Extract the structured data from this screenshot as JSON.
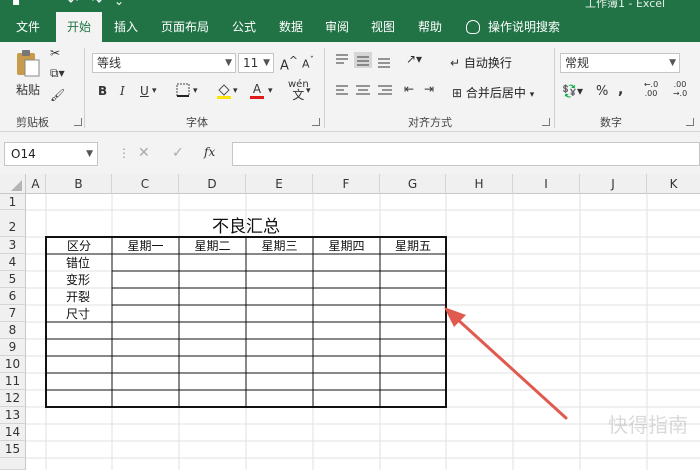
{
  "window": {
    "title_fragment": "工作簿1 - Excel"
  },
  "tabs": [
    {
      "label": "文件",
      "active": false
    },
    {
      "label": "开始",
      "active": true
    },
    {
      "label": "插入",
      "active": false
    },
    {
      "label": "页面布局",
      "active": false
    },
    {
      "label": "公式",
      "active": false
    },
    {
      "label": "数据",
      "active": false
    },
    {
      "label": "审阅",
      "active": false
    },
    {
      "label": "视图",
      "active": false
    },
    {
      "label": "帮助",
      "active": false
    }
  ],
  "tell_me": "操作说明搜索",
  "ribbon": {
    "clipboard": {
      "paste_label": "粘贴",
      "group_label": "剪贴板"
    },
    "font": {
      "font_name": "等线",
      "font_size": "11",
      "group_label": "字体",
      "bold": "B",
      "italic": "I",
      "underline": "U",
      "grow": "A",
      "shrink": "A",
      "fill_char": "A",
      "phonetic": "wén"
    },
    "alignment": {
      "wrap_label": "自动换行",
      "merge_label": "合并后居中",
      "group_label": "对齐方式"
    },
    "number": {
      "format": "常规",
      "percent": "%",
      "comma": ",",
      "inc_decimal": "←.0 .00",
      "dec_decimal": ".00 →.0",
      "group_label": "数字"
    }
  },
  "formula_bar": {
    "name_box": "O14",
    "fx": "fx",
    "cancel": "✕",
    "enter": "✓",
    "value": ""
  },
  "columns": [
    "A",
    "B",
    "C",
    "D",
    "E",
    "F",
    "G",
    "H",
    "I",
    "J",
    "K"
  ],
  "rows": [
    "1",
    "2",
    "3",
    "4",
    "5",
    "6",
    "7",
    "8",
    "9",
    "10",
    "11",
    "12",
    "13",
    "14",
    "15"
  ],
  "sheet": {
    "title": "不良汇总",
    "header": [
      "区分",
      "星期一",
      "星期二",
      "星期三",
      "星期四",
      "星期五"
    ],
    "row_labels": [
      "错位",
      "变形",
      "开裂",
      "尺寸"
    ]
  },
  "watermark": "快得指南",
  "colors": {
    "excel_green": "#217346",
    "annotation_arrow": "#e05a4f"
  }
}
